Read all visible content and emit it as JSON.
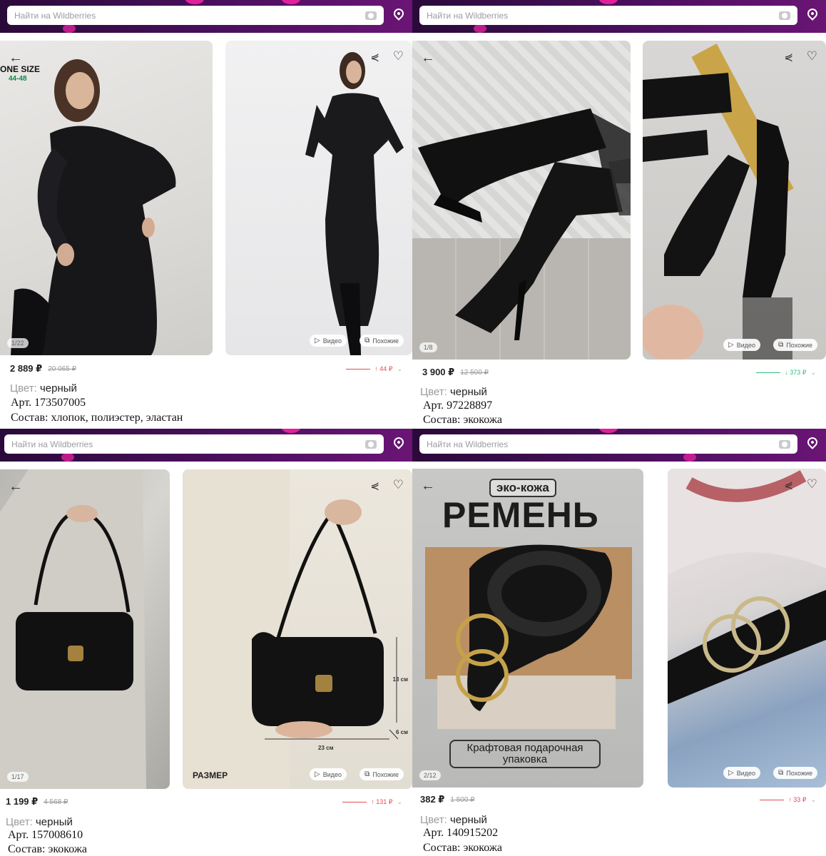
{
  "search": {
    "placeholder": "Найти на Wildberries"
  },
  "common": {
    "video_label": "Видео",
    "similar_label": "Похожие",
    "color_label": "Цвет:"
  },
  "products": [
    {
      "counter": "1/22",
      "price": "2 889 ₽",
      "old_price": "20 065 ₽",
      "delta": "↑ 44 ₽",
      "delta_direction": "up",
      "color": "черный",
      "article": "Арт. 173507005",
      "composition": "Состав: хлопок, полиэстер, эластан",
      "badge_title": "ONE SIZE",
      "badge_sizes": "44-48"
    },
    {
      "counter": "1/8",
      "price": "3 900 ₽",
      "old_price": "12 500 ₽",
      "delta": "↓ 373 ₽",
      "delta_direction": "down",
      "color": "черный",
      "article": "Арт. 97228897",
      "composition": "Состав: экокожа"
    },
    {
      "counter": "1/17",
      "price": "1 199 ₽",
      "old_price": "4 568 ₽",
      "delta": "↑ 131 ₽",
      "delta_direction": "up",
      "color": "черный",
      "article": "Арт. 157008610",
      "composition": "Состав: экокожа",
      "size_label": "РАЗМЕР",
      "dim_height": "13 см",
      "dim_width": "23 см",
      "dim_depth": "6 см"
    },
    {
      "counter": "2/12",
      "price": "382 ₽",
      "old_price": "1 500 ₽",
      "delta": "↑ 33 ₽",
      "delta_direction": "up",
      "color": "черный",
      "article": "Арт. 140915202",
      "composition": "Состав: экокожа",
      "banner_tag": "эко-кожа",
      "banner_title": "РЕМЕНЬ",
      "banner_footer": "Крафтовая подарочная упаковка"
    }
  ],
  "colors": {
    "brand_dark": "#2a0a3a",
    "brand_pink": "#e0219a",
    "price_up": "#e44b55",
    "price_down": "#2ebf7e"
  }
}
